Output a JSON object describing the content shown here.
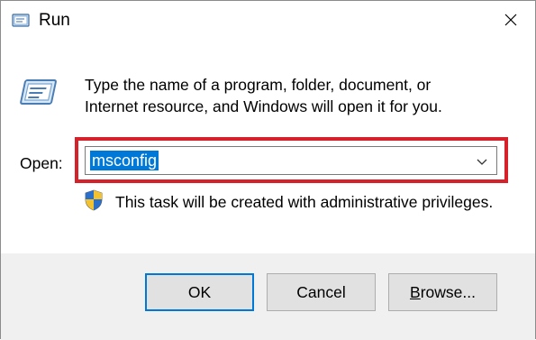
{
  "window": {
    "title": "Run",
    "close_glyph": "✕"
  },
  "dialog": {
    "description_line1": "Type the name of a program, folder, document, or",
    "description_line2": "Internet resource, and Windows will open it for you.",
    "open_label": "Open:",
    "open_value": "msconfig",
    "admin_notice": "This task will be created with administrative privileges."
  },
  "buttons": {
    "ok": "OK",
    "cancel": "Cancel",
    "browse_underlined": "B",
    "browse_rest": "rowse..."
  },
  "icons": {
    "app": "run-app-icon",
    "close": "close-icon",
    "dropdown": "chevron-down-icon",
    "shield": "uac-shield-icon"
  },
  "colors": {
    "selection": "#0078d7",
    "highlight_border": "#d6202a",
    "footer_bg": "#f0f0f0"
  }
}
